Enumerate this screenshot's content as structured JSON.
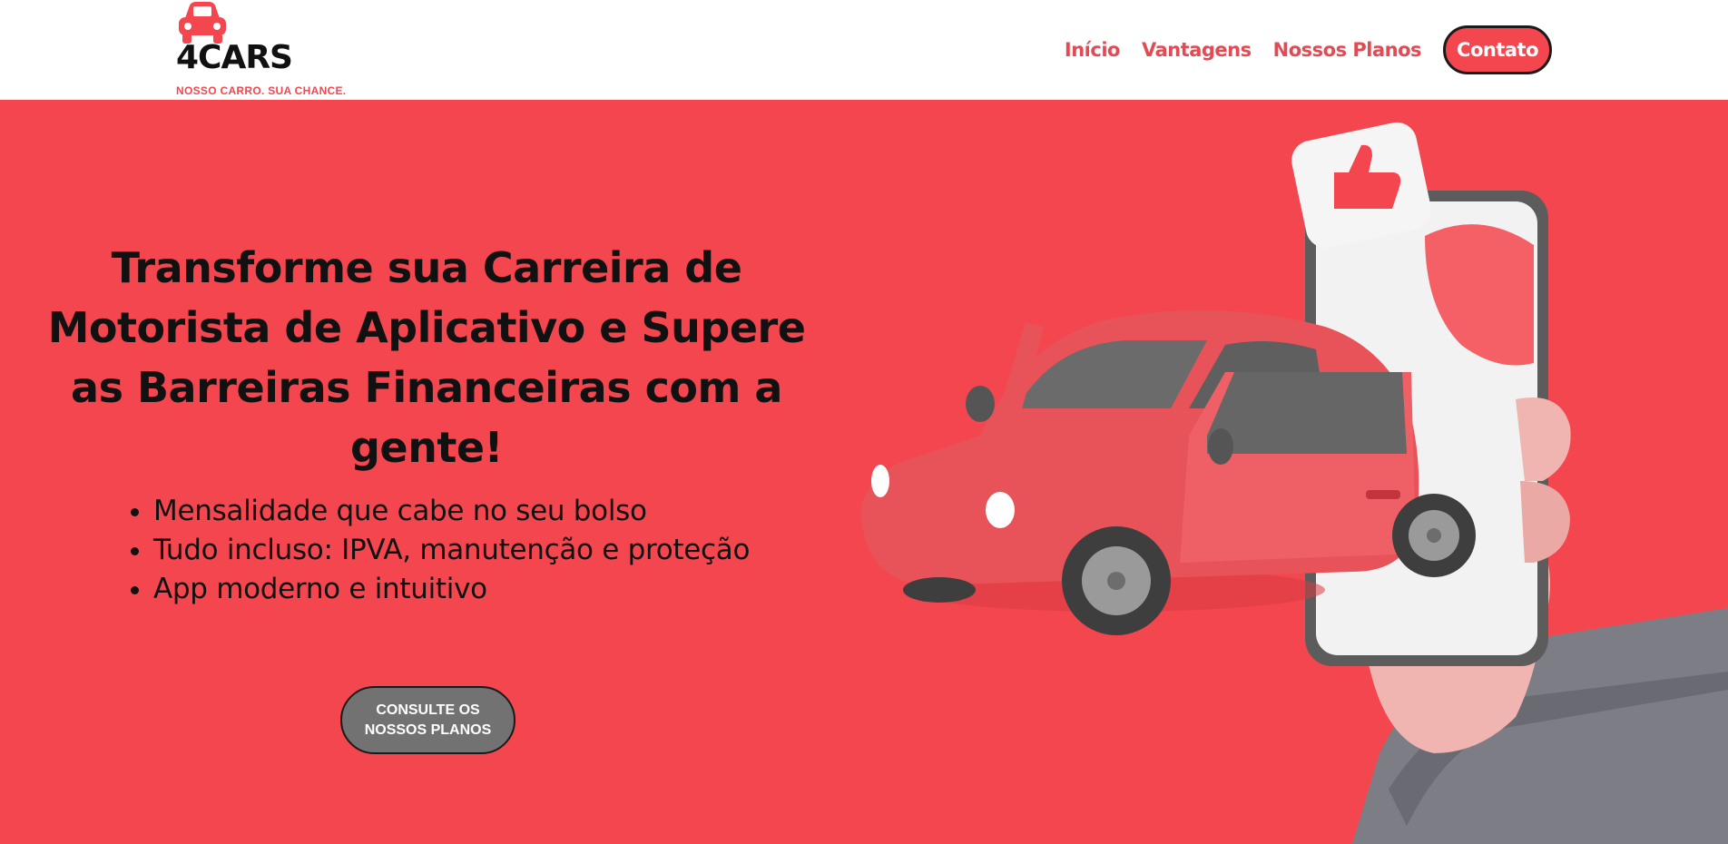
{
  "brand": {
    "name": "4CARS",
    "tagline": "NOSSO CARRO. SUA CHANCE.",
    "logo_icon": "car-icon",
    "accent_color": "#f4464e"
  },
  "nav": {
    "items": [
      {
        "label": "Início"
      },
      {
        "label": "Vantagens"
      },
      {
        "label": "Nossos Planos"
      }
    ],
    "contact_label": "Contato"
  },
  "hero": {
    "title": "Transforme sua Carreira de Motorista de Aplicativo e Supere as Barreiras Financeiras com a gente!",
    "benefits": [
      "Mensalidade que cabe no seu bolso",
      "Tudo incluso: IPVA, manutenção e proteção",
      "App moderno e intuitivo"
    ],
    "cta_label": "CONSULTE OS NOSSOS PLANOS",
    "background_color": "#f4464e",
    "illustration": "hand-holding-phone-with-car-illustration"
  }
}
